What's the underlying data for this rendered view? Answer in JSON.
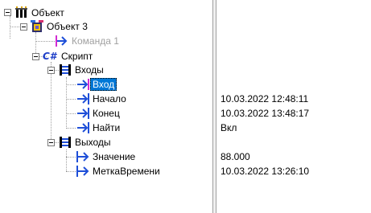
{
  "tree": {
    "root": {
      "label": "Объект",
      "icon": "object-icon"
    },
    "object3": {
      "label": "Объект 3",
      "icon": "object-class-icon"
    },
    "command1": {
      "label": "Команда 1",
      "icon": "command-arrow-icon"
    },
    "script": {
      "label": "Скрипт",
      "icon": "csharp-icon",
      "icon_text": "C#"
    },
    "inputs": {
      "label": "Входы",
      "icon": "io-group-icon"
    },
    "input_vhod": {
      "label": "Вход",
      "icon": "input-arrow-icon"
    },
    "input_start": {
      "label": "Начало",
      "icon": "input-arrow-icon"
    },
    "input_end": {
      "label": "Конец",
      "icon": "input-arrow-icon"
    },
    "input_find": {
      "label": "Найти",
      "icon": "input-arrow-icon"
    },
    "outputs": {
      "label": "Выходы",
      "icon": "io-group-icon"
    },
    "output_value": {
      "label": "Значение",
      "icon": "output-arrow-icon"
    },
    "output_timestamp": {
      "label": "МеткаВремени",
      "icon": "output-arrow-icon"
    }
  },
  "values": {
    "input_start": "10.03.2022 12:48:11",
    "input_end": "10.03.2022 13:48:17",
    "input_find": "Вкл",
    "output_value": "88.000",
    "output_timestamp": "10.03.2022 13:26:10"
  },
  "colors": {
    "selection": "#0078d7",
    "arrow_blue": "#1f4fd8",
    "arrow_magenta": "#d32bd3",
    "disabled_text": "#a0a0a0"
  }
}
